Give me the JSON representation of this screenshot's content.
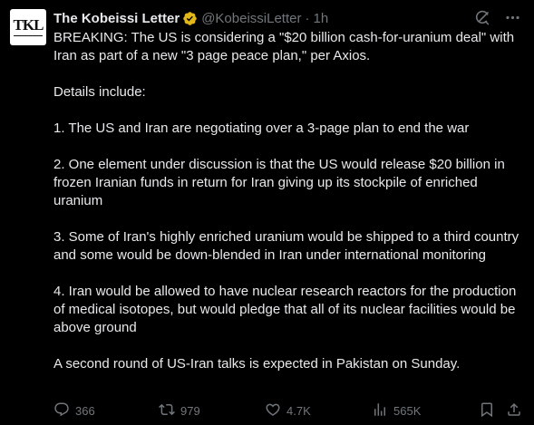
{
  "author": {
    "avatar_text": "TKL",
    "name": "The Kobeissi Letter",
    "handle": "@KobeissiLetter",
    "separator": "·",
    "time": "1h"
  },
  "tweet": {
    "paragraphs": [
      "BREAKING: The US is considering a \"$20 billion cash-for-uranium deal\" with Iran as part of a new \"3 page peace plan,\" per Axios.",
      "Details include:",
      "1. The US and Iran are negotiating over a 3-page plan to end the war",
      "2. One element under discussion is that the US would release $20 billion in frozen Iranian funds in return for Iran giving up its stockpile of enriched uranium",
      "3. Some of Iran's highly enriched uranium would be shipped to a third country and some would be down-blended in Iran under international monitoring",
      "4. Iran would be allowed to have nuclear research reactors for the production of medical isotopes, but would pledge that all of its nuclear facilities would be above ground",
      "A second round of US-Iran talks is expected in Pakistan on Sunday."
    ]
  },
  "actions": {
    "replies": "366",
    "reposts": "979",
    "likes": "4.7K",
    "views": "565K"
  },
  "icons": {
    "verified": "verified-gold-badge-icon",
    "grok": "grok-icon",
    "more": "more-icon",
    "reply": "reply-icon",
    "repost": "repost-icon",
    "like": "like-icon",
    "views": "views-icon",
    "bookmark": "bookmark-icon",
    "share": "share-icon"
  },
  "colors": {
    "background": "#000000",
    "text": "#e7e9ea",
    "secondary": "#71767b",
    "verified_gold": "#e2b719"
  }
}
